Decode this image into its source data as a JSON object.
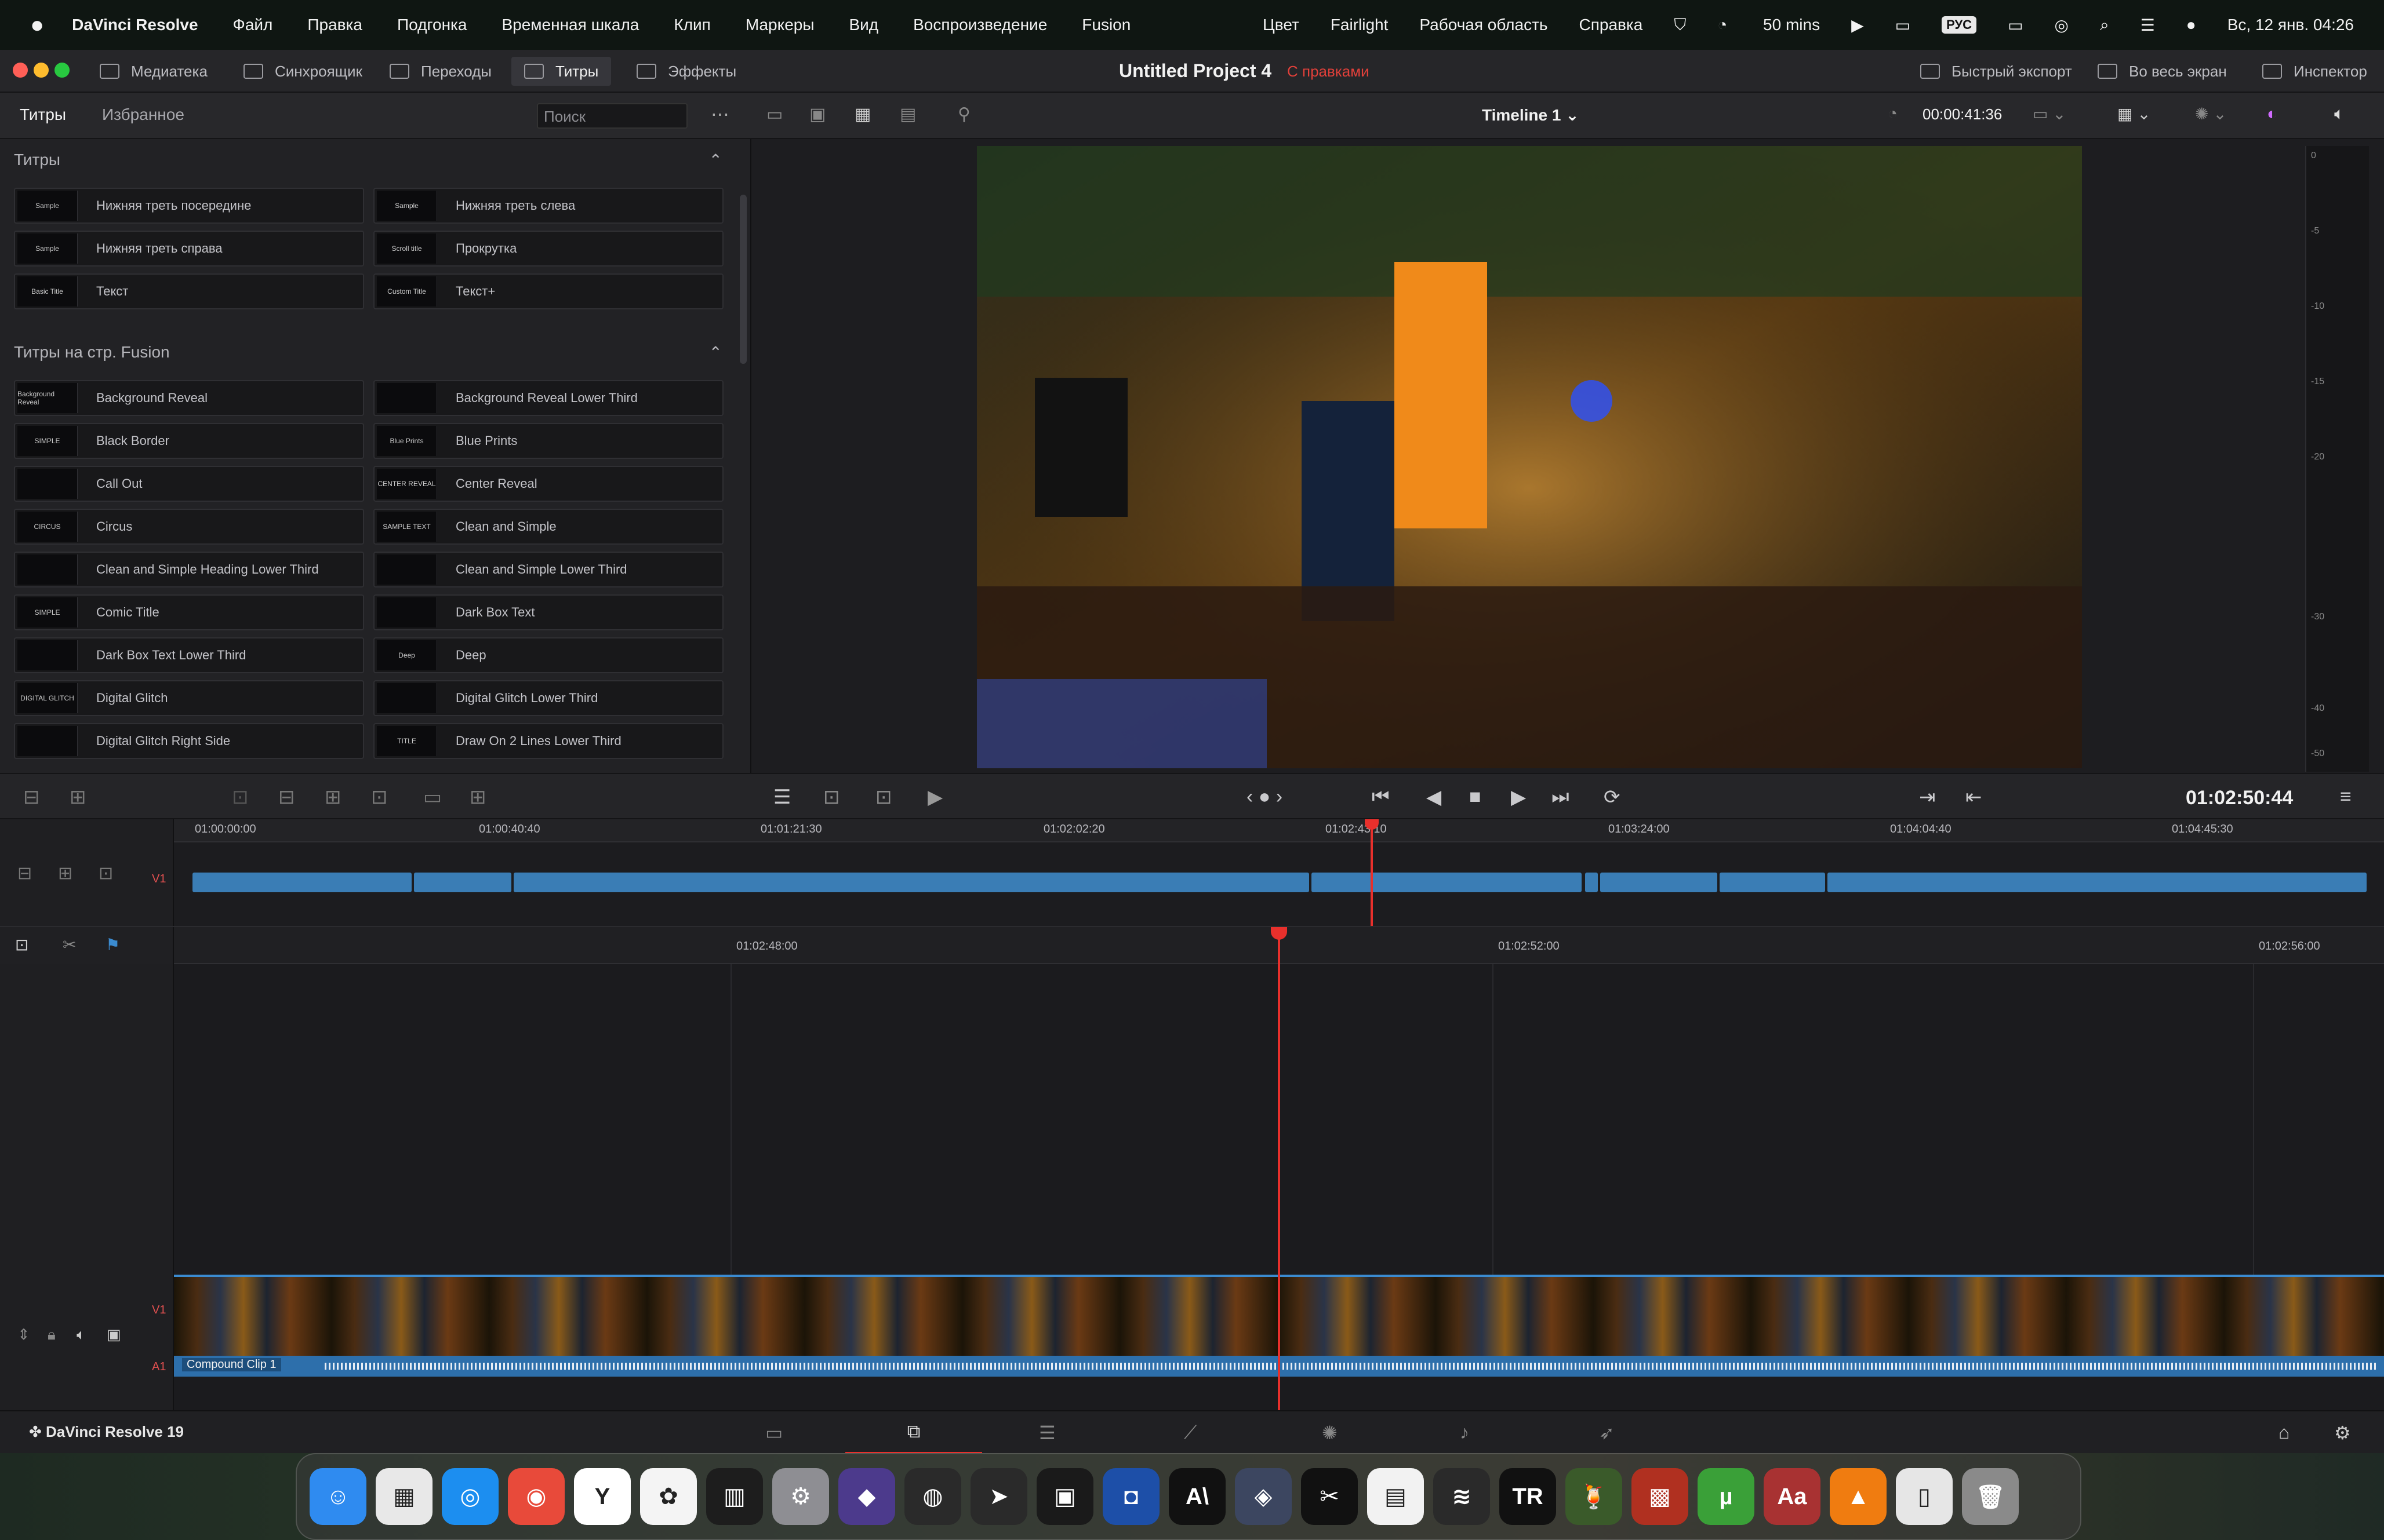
{
  "menubar": {
    "apple": "",
    "app_name": "DaVinci Resolve",
    "items": [
      "Файл",
      "Правка",
      "Подгонка",
      "Временная шкала",
      "Клип",
      "Маркеры",
      "Вид",
      "Воспроизведение",
      "Fusion"
    ],
    "right_items": [
      "Цвет",
      "Fairlight",
      "Рабочая область",
      "Справка"
    ],
    "timer": "50 mins",
    "input_source": "РУС",
    "clock": "Вс, 12 янв.  04:26"
  },
  "titlebar": {
    "tabs": [
      "Медиатека",
      "Синхроящик",
      "Переходы",
      "Титры",
      "Эффекты"
    ],
    "active_tab": "Титры",
    "project_title": "Untitled Project 4",
    "project_status": "С правками",
    "right": [
      "Быстрый экспорт",
      "Во весь экран",
      "Инспектор"
    ]
  },
  "left_panel": {
    "tabs": [
      "Титры",
      "Избранное"
    ],
    "search_placeholder": "Поиск",
    "section1": "Титры",
    "titles": [
      {
        "name": "Нижняя треть посередине",
        "thumb": "Sample"
      },
      {
        "name": "Нижняя треть слева",
        "thumb": "Sample"
      },
      {
        "name": "Нижняя треть справа",
        "thumb": "Sample"
      },
      {
        "name": "Прокрутка",
        "thumb": "Scroll title"
      },
      {
        "name": "Текст",
        "thumb": "Basic Title"
      },
      {
        "name": "Текст+",
        "thumb": "Custom Title"
      }
    ],
    "section2": "Титры на стр. Fusion",
    "fusion_titles": [
      {
        "name": "Background Reveal",
        "thumb": "Background Reveal"
      },
      {
        "name": "Background Reveal Lower Third",
        "thumb": ""
      },
      {
        "name": "Black Border",
        "thumb": "SIMPLE"
      },
      {
        "name": "Blue Prints",
        "thumb": "Blue Prints"
      },
      {
        "name": "Call Out",
        "thumb": ""
      },
      {
        "name": "Center Reveal",
        "thumb": "CENTER REVEAL"
      },
      {
        "name": "Circus",
        "thumb": "CIRCUS"
      },
      {
        "name": "Clean and Simple",
        "thumb": "SAMPLE TEXT"
      },
      {
        "name": "Clean and Simple Heading Lower Third",
        "thumb": ""
      },
      {
        "name": "Clean and Simple Lower Third",
        "thumb": ""
      },
      {
        "name": "Comic Title",
        "thumb": "SIMPLE"
      },
      {
        "name": "Dark Box Text",
        "thumb": ""
      },
      {
        "name": "Dark Box Text Lower Third",
        "thumb": ""
      },
      {
        "name": "Deep",
        "thumb": "Deep"
      },
      {
        "name": "Digital Glitch",
        "thumb": "DIGITAL GLITCH"
      },
      {
        "name": "Digital Glitch Lower Third",
        "thumb": ""
      },
      {
        "name": "Digital Glitch Right Side",
        "thumb": ""
      },
      {
        "name": "Draw On 2 Lines Lower Third",
        "thumb": "TITLE"
      }
    ]
  },
  "viewer": {
    "timeline_name": "Timeline 1",
    "duration": "00:00:41:36",
    "vu_labels": [
      "0",
      "-5",
      "-10",
      "-15",
      "-20",
      "-30",
      "-40",
      "-50"
    ]
  },
  "transport": {
    "timecode": "01:02:50:44"
  },
  "upper_timeline": {
    "ticks": [
      "01:00:00:00",
      "01:00:40:40",
      "01:01:21:30",
      "01:02:02:20",
      "01:02:43:10",
      "01:03:24:00",
      "01:04:04:40",
      "01:04:45:30"
    ],
    "track": "V1"
  },
  "lower_timeline": {
    "ticks": [
      "01:02:48:00",
      "01:02:52:00",
      "01:02:56:00"
    ],
    "video_track": "V1",
    "audio_track": "A1",
    "clip_name": "Compound Clip 1"
  },
  "pagebar": {
    "app_label": "DaVinci Resolve 19"
  },
  "dock": {
    "apps": [
      {
        "name": "finder",
        "label": "☺",
        "color": "#2f8bf0"
      },
      {
        "name": "launchpad",
        "label": "▦",
        "color": "#e8e8e8"
      },
      {
        "name": "safari",
        "label": "◎",
        "color": "#1c8ef0"
      },
      {
        "name": "chrome",
        "label": "◉",
        "color": "#e84a3a"
      },
      {
        "name": "yandex",
        "label": "Y",
        "color": "#ffffff"
      },
      {
        "name": "photos",
        "label": "✿",
        "color": "#f4f4f4"
      },
      {
        "name": "activity-monitor",
        "label": "▥",
        "color": "#1d1d1d"
      },
      {
        "name": "system-settings",
        "label": "⚙",
        "color": "#8e8e93"
      },
      {
        "name": "obsidian",
        "label": "◆",
        "color": "#4c3a8c"
      },
      {
        "name": "cinema-app",
        "label": "◍",
        "color": "#2a2a2a"
      },
      {
        "name": "telegram",
        "label": "➤",
        "color": "#2a2a2a"
      },
      {
        "name": "cube-app",
        "label": "▣",
        "color": "#1a1a1a"
      },
      {
        "name": "finder-ghost",
        "label": "◘",
        "color": "#1d4fa8"
      },
      {
        "name": "ai-app",
        "label": "A\\",
        "color": "#111111"
      },
      {
        "name": "davinci-resolve",
        "label": "◈",
        "color": "#3c4660"
      },
      {
        "name": "capcut",
        "label": "✂",
        "color": "#111111"
      },
      {
        "name": "claquette",
        "label": "▤",
        "color": "#f2f2f2"
      },
      {
        "name": "waveform-app",
        "label": "≋",
        "color": "#2a2a2a"
      },
      {
        "name": "tr-app",
        "label": "TR",
        "color": "#111111"
      },
      {
        "name": "drink-app",
        "label": "🍹",
        "color": "#3a5a2a"
      },
      {
        "name": "photo-booth",
        "label": "▩",
        "color": "#b03020"
      },
      {
        "name": "utorrent",
        "label": "µ",
        "color": "#3aa038"
      },
      {
        "name": "dictionary",
        "label": "Aa",
        "color": "#a83232"
      },
      {
        "name": "vlc",
        "label": "▲",
        "color": "#f07c10"
      },
      {
        "name": "documents",
        "label": "▯",
        "color": "#e6e6e6"
      },
      {
        "name": "trash",
        "label": "🗑",
        "color": "#8a8a8a"
      }
    ]
  }
}
